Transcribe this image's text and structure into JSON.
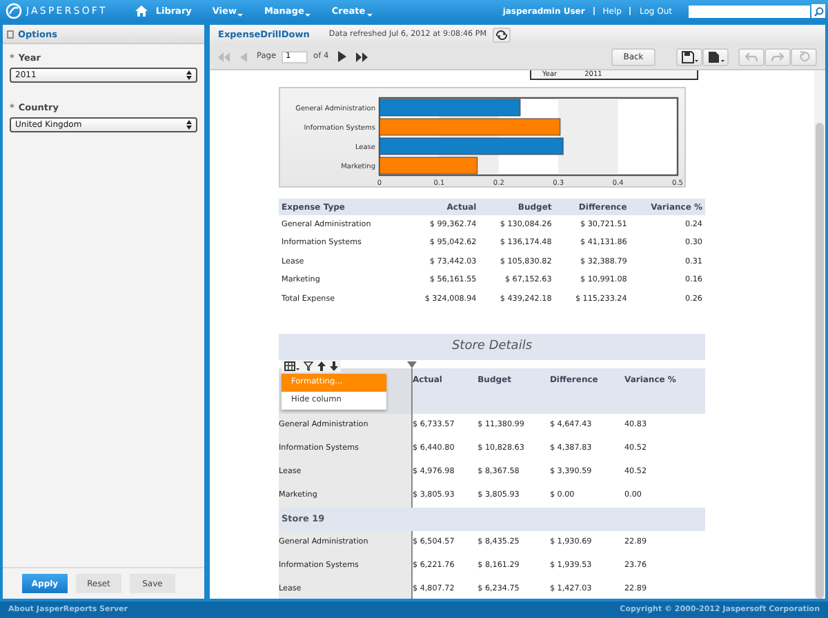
{
  "top_nav": {
    "logo": "JASPERSOFT",
    "menu": [
      {
        "label": "Library",
        "has_menu": false
      },
      {
        "label": "View",
        "has_menu": true
      },
      {
        "label": "Manage",
        "has_menu": true
      },
      {
        "label": "Create",
        "has_menu": true
      }
    ],
    "user": "jasperadmin User",
    "links": [
      "Help",
      "Log Out"
    ]
  },
  "options_panel": {
    "title": "Options",
    "fields": [
      {
        "required_mark": "*",
        "label": "Year",
        "value": "2011"
      },
      {
        "required_mark": "*",
        "label": "Country",
        "value": "United Kingdom"
      }
    ],
    "buttons": [
      {
        "label": "Apply",
        "primary": true
      },
      {
        "label": "Reset",
        "primary": false
      },
      {
        "label": "Save",
        "primary": false
      }
    ]
  },
  "report": {
    "title": "ExpenseDrillDown",
    "refresh_note": "Data refreshed Jul 6, 2012 at 9:08:46 PM",
    "pager": {
      "label": "Page",
      "page": "1",
      "total": "of 4"
    },
    "back": "Back",
    "param_box": [
      "Year",
      "2011"
    ],
    "chart_data": {
      "type": "bar",
      "orientation": "horizontal",
      "categories": [
        "General Administration",
        "Information Systems",
        "Lease",
        "Marketing"
      ],
      "values": [
        0.236,
        0.303,
        0.308,
        0.164
      ],
      "colors": [
        "#127fc6",
        "#ff7f00",
        "#127fc6",
        "#ff7f00"
      ],
      "xlim": [
        0,
        0.5
      ],
      "xticks": [
        0,
        0.1,
        0.2,
        0.3,
        0.4,
        0.5
      ]
    },
    "summary_table": {
      "columns": [
        "Expense Type",
        "Actual",
        "Budget",
        "Difference",
        "Variance %"
      ],
      "rows": [
        [
          "General Administration",
          "$ 99,362.74",
          "$ 130,084.26",
          "$ 30,721.51",
          "0.24"
        ],
        [
          "Information Systems",
          "$ 95,042.62",
          "$ 136,174.48",
          "$ 41,131.86",
          "0.30"
        ],
        [
          "Lease",
          "$ 73,442.03",
          "$ 105,830.82",
          "$ 32,388.79",
          "0.31"
        ],
        [
          "Marketing",
          "$ 56,161.55",
          "$ 67,152.63",
          "$ 10,991.08",
          "0.16"
        ],
        [
          "Total Expense",
          "$ 324,008.94",
          "$ 439,242.18",
          "$ 115,233.24",
          "0.26"
        ]
      ]
    },
    "store_details": {
      "title": "Store Details",
      "columns": [
        "",
        "Actual",
        "Budget",
        "Difference",
        "Variance %"
      ],
      "menu": [
        {
          "label": "Formatting...",
          "selected": true
        },
        {
          "label": "Hide column",
          "selected": false
        }
      ],
      "rows": [
        {
          "kind": "row",
          "cells": [
            "General Administration",
            "$ 6,733.57",
            "$ 11,380.99",
            "$ 4,647.43",
            "40.83"
          ]
        },
        {
          "kind": "row",
          "cells": [
            "Information Systems",
            "$ 6,440.80",
            "$ 10,828.63",
            "$ 4,387.83",
            "40.52"
          ]
        },
        {
          "kind": "row",
          "cells": [
            "Lease",
            "$ 4,976.98",
            "$ 8,367.58",
            "$ 3,390.59",
            "40.52"
          ]
        },
        {
          "kind": "row",
          "cells": [
            "Marketing",
            "$ 3,805.93",
            "$ 3,805.93",
            "$ 0.00",
            "0.00"
          ]
        },
        {
          "kind": "group",
          "cells": [
            "Store 19",
            "",
            "",
            "",
            ""
          ]
        },
        {
          "kind": "row",
          "cells": [
            "General Administration",
            "$ 6,504.57",
            "$ 8,435.25",
            "$ 1,930.69",
            "22.89"
          ]
        },
        {
          "kind": "row",
          "cells": [
            "Information Systems",
            "$ 6,221.76",
            "$ 8,161.29",
            "$ 1,939.53",
            "23.76"
          ]
        },
        {
          "kind": "row",
          "cells": [
            "Lease",
            "$ 4,807.72",
            "$ 6,234.75",
            "$ 1,427.03",
            "22.89"
          ]
        }
      ]
    }
  },
  "footer": {
    "left": "About JasperReports Server",
    "right": "Copyright © 2000-2012 Jaspersoft Corporation"
  }
}
